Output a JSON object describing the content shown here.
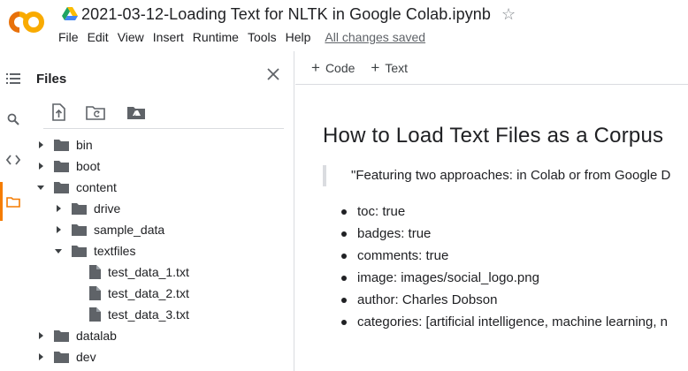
{
  "colors": {
    "accent": "#f57c00",
    "logo_orange": "#f9ab00",
    "logo_dark": "#e8710a",
    "icon_grey": "#5f6368"
  },
  "header": {
    "doc_title": "2021-03-12-Loading Text for NLTK in Google Colab.ipynb",
    "menu": [
      "File",
      "Edit",
      "View",
      "Insert",
      "Runtime",
      "Tools",
      "Help"
    ],
    "save_status": "All changes saved"
  },
  "rail": {
    "icons": [
      "toc-icon",
      "search-icon",
      "code-icon",
      "folder-icon"
    ]
  },
  "files_panel": {
    "title": "Files",
    "toolbar_icons": [
      "upload-icon",
      "refresh-folder-icon",
      "mount-drive-icon"
    ],
    "tree": [
      {
        "label": "bin",
        "type": "folder",
        "depth": 0,
        "expanded": false
      },
      {
        "label": "boot",
        "type": "folder",
        "depth": 0,
        "expanded": false
      },
      {
        "label": "content",
        "type": "folder",
        "depth": 0,
        "expanded": true
      },
      {
        "label": "drive",
        "type": "folder",
        "depth": 1,
        "expanded": false
      },
      {
        "label": "sample_data",
        "type": "folder",
        "depth": 1,
        "expanded": false
      },
      {
        "label": "textfiles",
        "type": "folder",
        "depth": 1,
        "expanded": true
      },
      {
        "label": "test_data_1.txt",
        "type": "file",
        "depth": 2
      },
      {
        "label": "test_data_2.txt",
        "type": "file",
        "depth": 2
      },
      {
        "label": "test_data_3.txt",
        "type": "file",
        "depth": 2
      },
      {
        "label": "datalab",
        "type": "folder",
        "depth": 0,
        "expanded": false
      },
      {
        "label": "dev",
        "type": "folder",
        "depth": 0,
        "expanded": false
      }
    ]
  },
  "notebook": {
    "toolbar": {
      "code_label": "Code",
      "text_label": "Text"
    },
    "heading": "How to Load Text Files as a Corpus",
    "quote": "\"Featuring two approaches: in Colab or from Google D",
    "bullets": [
      "toc: true",
      "badges: true",
      "comments: true",
      "image: images/social_logo.png",
      "author: Charles Dobson",
      "categories: [artificial intelligence, machine learning, n"
    ]
  }
}
